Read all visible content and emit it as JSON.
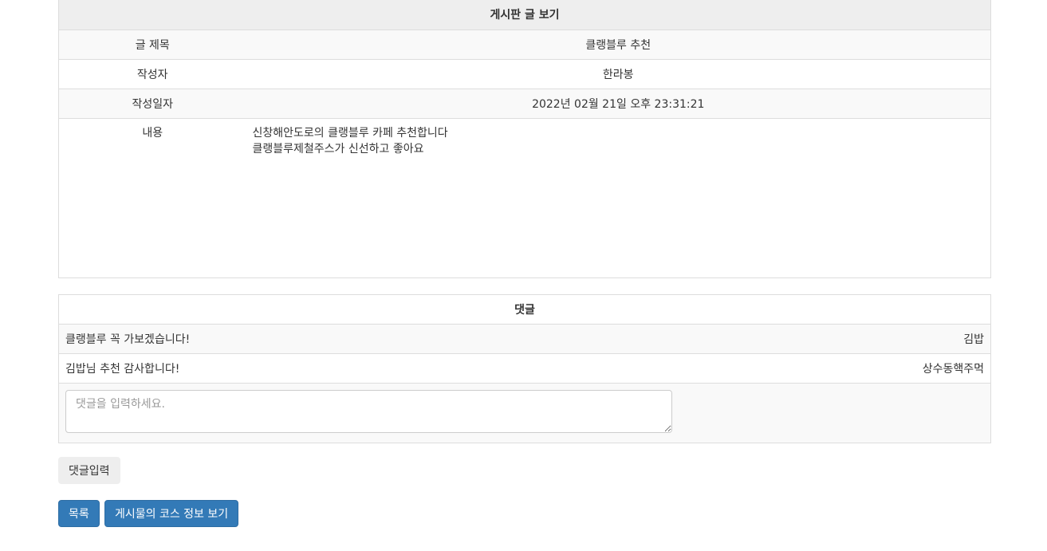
{
  "post": {
    "header": "게시판 글 보기",
    "rows": [
      {
        "label": "글 제목",
        "value": "클랭블루 추천"
      },
      {
        "label": "작성자",
        "value": "한라봉"
      },
      {
        "label": "작성일자",
        "value": "2022년 02월 21일 오후 23:31:21"
      }
    ],
    "content_label": "내용",
    "content_lines": [
      "신창해안도로의 클랭블루 카페 추천합니다",
      "클랭블루제철주스가 신선하고 좋아요"
    ]
  },
  "comments": {
    "header": "댓글",
    "items": [
      {
        "text": "클랭블루 꼭 가보겠습니다!",
        "author": "김밥"
      },
      {
        "text": "김밥님 추천 감사합니다!",
        "author": "상수동핵주먹"
      }
    ],
    "input_placeholder": "댓글을 입력하세요."
  },
  "buttons": {
    "submit_comment": "댓글입력",
    "list": "목록",
    "course_info": "게시물의 코스 정보 보기"
  }
}
